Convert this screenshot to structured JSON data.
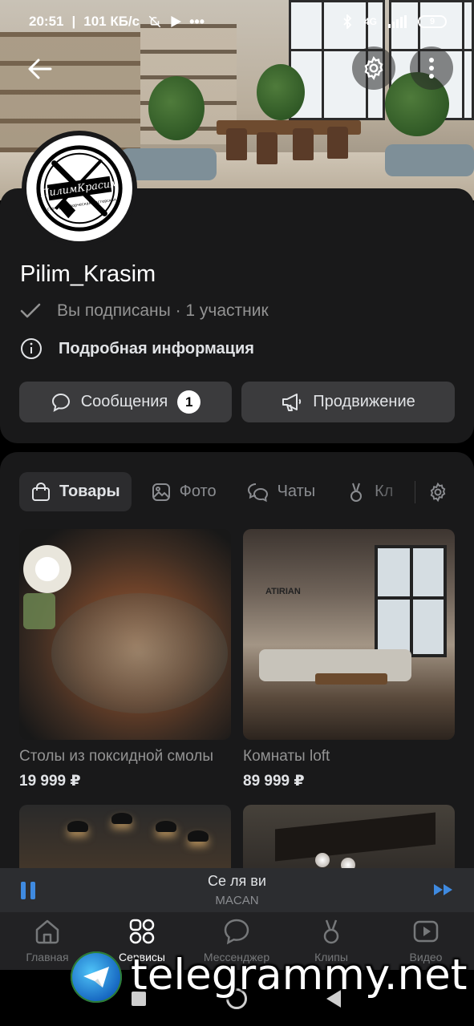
{
  "status_bar": {
    "time": "20:51",
    "speed": "101 КБ/с",
    "network": "4G",
    "battery": "9"
  },
  "community": {
    "name": "Pilim_Krasim",
    "subscription_status": "Вы подписаны",
    "members": "1 участник",
    "details_label": "Подробная информация",
    "logo_text": "ПилимКрасим",
    "logo_subtext": "столярно-творческая мастерская"
  },
  "actions": {
    "messages_label": "Сообщения",
    "messages_badge": "1",
    "promotion_label": "Продвижение"
  },
  "tabs": [
    {
      "label": "Товары",
      "icon": "bag-icon",
      "active": true
    },
    {
      "label": "Фото",
      "icon": "photo-icon",
      "active": false
    },
    {
      "label": "Чаты",
      "icon": "chats-icon",
      "active": false
    },
    {
      "label": "Кл",
      "icon": "clips-icon",
      "active": false
    }
  ],
  "products": [
    {
      "title": "Столы из поксидной смолы",
      "price": "19 999 ₽"
    },
    {
      "title": "Комнаты loft",
      "price": "89 999 ₽"
    },
    {
      "title": "",
      "price": ""
    },
    {
      "title": "",
      "price": ""
    }
  ],
  "loft_sign": "ATIRIAN",
  "player": {
    "track": "Се ля ви",
    "artist": "MACAN",
    "accent": "#3f8ae0"
  },
  "bottom_nav": [
    {
      "label": "Главная",
      "icon": "home-icon",
      "active": false
    },
    {
      "label": "Сервисы",
      "icon": "services-icon",
      "active": true
    },
    {
      "label": "Мессенджер",
      "icon": "messenger-icon",
      "active": false
    },
    {
      "label": "Клипы",
      "icon": "clips-icon",
      "active": false
    },
    {
      "label": "Видео",
      "icon": "video-icon",
      "active": false
    }
  ],
  "watermark": {
    "text": "telegrammy.net"
  }
}
